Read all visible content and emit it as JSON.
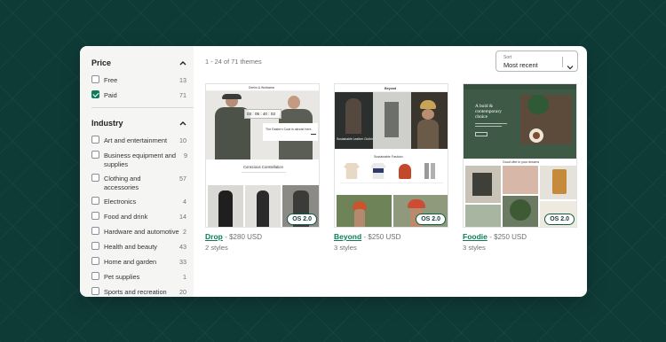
{
  "sidebar": {
    "price": {
      "title": "Price",
      "items": [
        {
          "label": "Free",
          "count": "13",
          "checked": false
        },
        {
          "label": "Paid",
          "count": "71",
          "checked": true
        }
      ]
    },
    "industry": {
      "title": "Industry",
      "items": [
        {
          "label": "Art and entertainment",
          "count": "10"
        },
        {
          "label": "Business equipment and supplies",
          "count": "9"
        },
        {
          "label": "Clothing and accessories",
          "count": "57"
        },
        {
          "label": "Electronics",
          "count": "4"
        },
        {
          "label": "Food and drink",
          "count": "14"
        },
        {
          "label": "Hardware and automotive",
          "count": "2"
        },
        {
          "label": "Health and beauty",
          "count": "43"
        },
        {
          "label": "Home and garden",
          "count": "33"
        },
        {
          "label": "Pet supplies",
          "count": "1"
        },
        {
          "label": "Sports and recreation",
          "count": "20"
        }
      ]
    }
  },
  "main": {
    "result_count": "1 - 24 of 71 themes",
    "sort": {
      "label": "Sort",
      "value": "Most recent"
    }
  },
  "themes": [
    {
      "name": "Drop",
      "price": "- $280 USD",
      "styles": "2 styles",
      "badge": "OS 2.0",
      "preview": {
        "brand": "Denim & Workwear",
        "countdown": "03 : 05 : 40 : 03",
        "hero_caption": "The Eastern Coat is almost here.",
        "collection_title": "Conscious Constellation"
      }
    },
    {
      "name": "Beyond",
      "price": "- $250 USD",
      "styles": "3 styles",
      "badge": "OS 2.0",
      "preview": {
        "brand": "Beyond",
        "hero_caption": "Sustainable Leather Clothing",
        "collection_title": "Sustainable Fashion"
      }
    },
    {
      "name": "Foodie",
      "price": "- $250 USD",
      "styles": "3 styles",
      "badge": "OS 2.0",
      "preview": {
        "hero_title": "A bold & contemporary choice",
        "gallery_caption": "Good vibe in your dreams"
      }
    }
  ],
  "colors": {
    "background": "#0f3b37",
    "accent": "#0f7a5a",
    "sidebar_bg": "#f5f5f4",
    "foodie_green": "#3e5a46"
  },
  "icons": {
    "collapse": "chevron-up-icon",
    "sort": "chevron-down-icon",
    "checkbox_checked": "check-icon"
  }
}
